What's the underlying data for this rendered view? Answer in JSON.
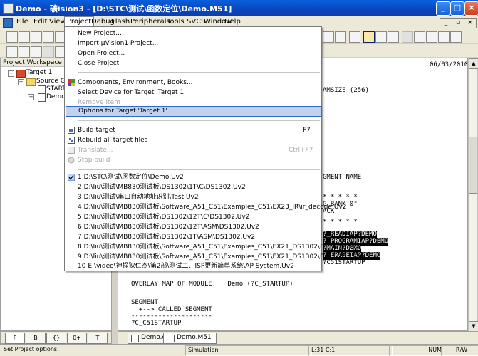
{
  "window": {
    "title": "Demo  - 礦ision3 - [D:\\STC\\测试\\函数定位\\Demo.M51]",
    "buttons": {
      "minimize": "_",
      "maximize": "□",
      "close": "×"
    }
  },
  "menubar": {
    "items": [
      "File",
      "Edit",
      "View",
      "Project",
      "Debug",
      "Flash",
      "Peripherals",
      "Tools",
      "SVCS",
      "Window",
      "Help"
    ],
    "mdi_buttons": [
      "_",
      "▫",
      "×"
    ]
  },
  "workspace": {
    "title": "Project Workspace",
    "tree": {
      "target": "Target 1",
      "group": "Source Gro",
      "files": [
        "STARTUP",
        "Demo.c"
      ]
    },
    "tabs": [
      "F",
      "B",
      "{}",
      "0+",
      "T"
    ]
  },
  "editor": {
    "date": "06/03/2010",
    "lines": [
      "AMSIZE (256)",
      "GMENT NAME",
      "* * * * *",
      "G BANK 0\"",
      "ACK",
      "* * * * *",
      "?_READIAP?DEMO",
      "?_PROGRAMIAP?DEMO",
      "?MAIN?DEMO",
      "?_ERASEIAP?DEMO",
      "?C51STARTUP",
      "OVERLAY MAP OF MODULE:   Demo (?C_STARTUP)",
      "SEGMENT",
      "  +--> CALLED SEGMENT",
      "---------------------",
      "?C_C51STARTUP"
    ],
    "tabs": [
      "Demo.c",
      "Demo.M51"
    ]
  },
  "project_menu": {
    "items": [
      {
        "label": "New Project...",
        "shortcut": "",
        "enabled": true,
        "icon": ""
      },
      {
        "label": "Import µVision1 Project...",
        "shortcut": "",
        "enabled": true,
        "icon": ""
      },
      {
        "label": "Open Project...",
        "shortcut": "",
        "enabled": true,
        "icon": ""
      },
      {
        "label": "Close Project",
        "shortcut": "",
        "enabled": true,
        "icon": ""
      },
      {
        "label": "Components, Environment, Books...",
        "shortcut": "",
        "enabled": true,
        "icon": "components-icon"
      },
      {
        "label": "Select Device for Target 'Target 1'",
        "shortcut": "",
        "enabled": true,
        "icon": ""
      },
      {
        "label": "Remove Item",
        "shortcut": "",
        "enabled": false,
        "icon": ""
      },
      {
        "label": "Options for Target 'Target 1'",
        "shortcut": "",
        "enabled": true,
        "icon": "",
        "highlighted": true
      },
      {
        "label": "Build target",
        "shortcut": "F7",
        "enabled": true,
        "icon": "build-icon"
      },
      {
        "label": "Rebuild all target files",
        "shortcut": "",
        "enabled": true,
        "icon": "rebuild-icon"
      },
      {
        "label": "Translate...",
        "shortcut": "Ctrl+F7",
        "enabled": false,
        "icon": "translate-icon"
      },
      {
        "label": "Stop build",
        "shortcut": "",
        "enabled": false,
        "icon": "stop-icon"
      },
      {
        "label": "1 D:\\STC\\测试\\函数定位\\Demo.Uv2",
        "shortcut": "",
        "enabled": true,
        "icon": "check-icon"
      },
      {
        "label": "2 D:\\liu\\测试\\MB830测试板\\DS1302\\1T\\C\\DS1302.Uv2",
        "shortcut": "",
        "enabled": true,
        "icon": ""
      },
      {
        "label": "3 D:\\liu\\测试\\串口自动地址识别\\Test.Uv2",
        "shortcut": "",
        "enabled": true,
        "icon": ""
      },
      {
        "label": "4 D:\\liu\\测试\\MB830测试板\\Software_A51_C51\\Examples_C51\\EX23_IR\\ir_decode.Uv2",
        "shortcut": "",
        "enabled": true,
        "icon": ""
      },
      {
        "label": "5 D:\\liu\\测试\\MB830测试板\\DS1302\\12T\\C\\DS1302.Uv2",
        "shortcut": "",
        "enabled": true,
        "icon": ""
      },
      {
        "label": "6 D:\\liu\\测试\\MB830测试板\\DS1302\\12T\\ASM\\DS1302.Uv2",
        "shortcut": "",
        "enabled": true,
        "icon": ""
      },
      {
        "label": "7 D:\\liu\\测试\\MB830测试板\\DS1302\\1T\\ASM\\DS1302.Uv2",
        "shortcut": "",
        "enabled": true,
        "icon": ""
      },
      {
        "label": "8 D:\\liu\\测试\\MB830测试板\\Software_A51_C51\\Examples_C51\\EX21_DS1302\\DS1302.Uv2",
        "shortcut": "",
        "enabled": true,
        "icon": ""
      },
      {
        "label": "9 D:\\liu\\测试\\MB830测试板\\Software_A51_C51\\Examples_C51\\EX21_DS1302\\DS1302.Uv2",
        "shortcut": "",
        "enabled": true,
        "icon": ""
      },
      {
        "label": "10 E:\\video\\神探狄仁杰\\第2部\\测试二、ISP更新简单系统\\AP System.Uv2",
        "shortcut": "",
        "enabled": true,
        "icon": ""
      }
    ]
  },
  "statusbar": {
    "message": "Set Project options",
    "mode": "Simulation",
    "position": "L:31 C:1",
    "num": "NUM",
    "rw": "R/W"
  },
  "colors": {
    "titlebar": "#0a4cc4",
    "highlight": "#c1d2ee",
    "highlight_border": "#316ac5"
  }
}
